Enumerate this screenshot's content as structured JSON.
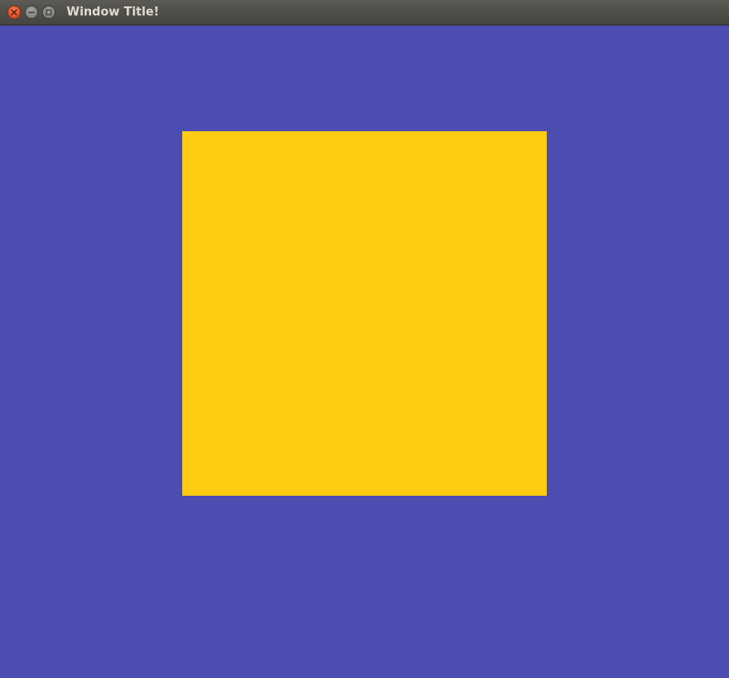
{
  "window": {
    "title": "Window Title!",
    "background_color": "#4b4db1"
  },
  "titlebar": {
    "buttons": [
      {
        "name": "close",
        "icon": "close-icon"
      },
      {
        "name": "minimize",
        "icon": "minimize-icon"
      },
      {
        "name": "maximize",
        "icon": "maximize-icon"
      }
    ]
  },
  "canvas": {
    "shape": "square",
    "fill_color": "#ffcc11"
  }
}
